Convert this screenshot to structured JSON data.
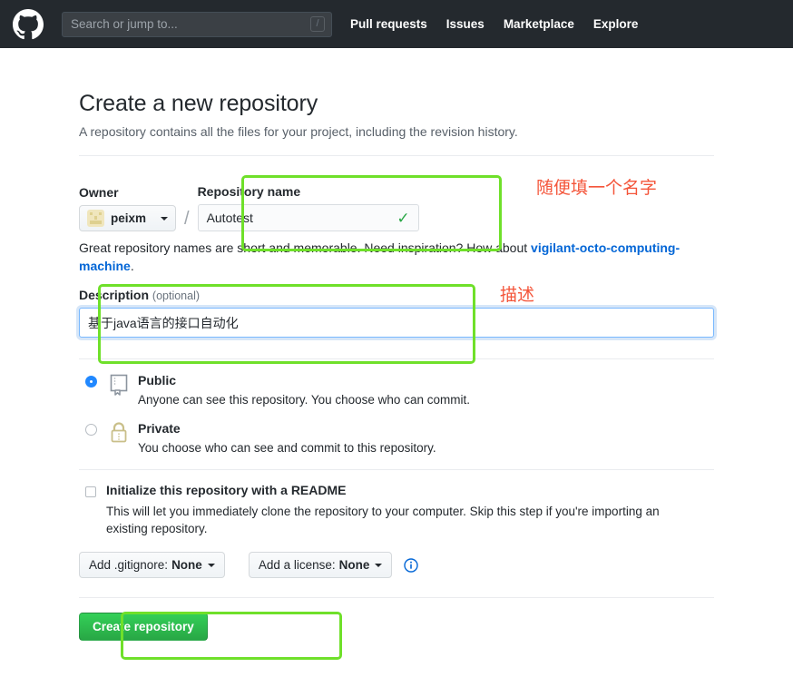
{
  "header": {
    "logo_icon": "github-mark-icon",
    "search": {
      "placeholder": "Search or jump to...",
      "shortcut_key": "/"
    },
    "nav": [
      {
        "label": "Pull requests"
      },
      {
        "label": "Issues"
      },
      {
        "label": "Marketplace"
      },
      {
        "label": "Explore"
      }
    ]
  },
  "main": {
    "title": "Create a new repository",
    "subtitle": "A repository contains all the files for your project, including the revision history.",
    "owner": {
      "label": "Owner",
      "value": "peixm",
      "separator": "/"
    },
    "repository_name": {
      "label": "Repository name",
      "value": "Autotest",
      "placeholder": "",
      "validation_icon": "check-icon",
      "validation_color": "#28a745"
    },
    "name_hint": {
      "prefix": "Great repository names are short and memorable. Need inspiration? How about ",
      "suggestion": "vigilant-octo-computing-machine",
      "suffix": "."
    },
    "description": {
      "label": "Description",
      "optional_label": "(optional)",
      "value": "基于java语言的接口自动化",
      "placeholder": ""
    },
    "visibility": [
      {
        "id": "public",
        "icon": "repo-book-icon",
        "title": "Public",
        "description": "Anyone can see this repository. You choose who can commit.",
        "selected": true
      },
      {
        "id": "private",
        "icon": "lock-icon",
        "title": "Private",
        "description": "You choose who can see and commit to this repository.",
        "selected": false
      }
    ],
    "readme": {
      "title": "Initialize this repository with a README",
      "description": "This will let you immediately clone the repository to your computer. Skip this step if you're importing an existing repository.",
      "checked": false
    },
    "gitignore": {
      "prefix": "Add .gitignore:",
      "value": "None"
    },
    "license": {
      "prefix": "Add a license:",
      "value": "None"
    },
    "info_icon": "info-circle-icon",
    "submit": {
      "label": "Create repository"
    }
  },
  "annotations": {
    "box_color": "#6fe02a",
    "text_color": "#f4553a",
    "notes": [
      {
        "id": "repo-name-note",
        "text": "随便填一个名字"
      },
      {
        "id": "description-note",
        "text": "描述"
      }
    ]
  }
}
